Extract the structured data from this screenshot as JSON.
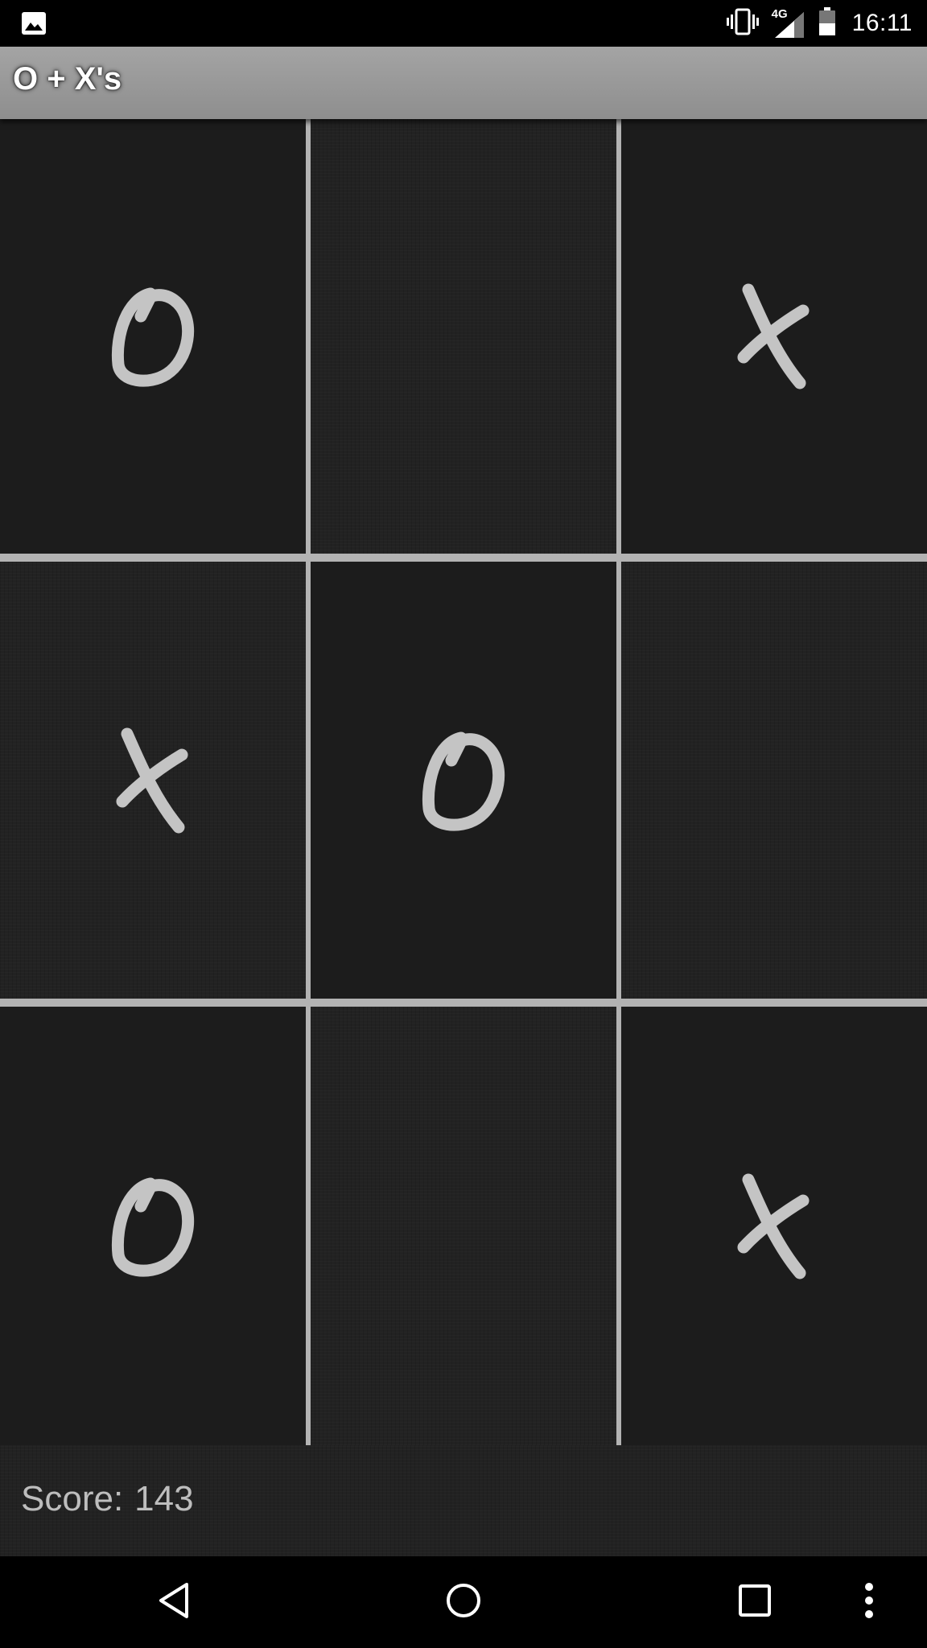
{
  "status_bar": {
    "time": "16:11",
    "network": "4G",
    "icons": [
      "image-notification-icon",
      "vibrate-icon",
      "signal-4g-icon",
      "battery-icon"
    ]
  },
  "app_bar": {
    "title": "O + X's"
  },
  "board": {
    "cells": [
      "O",
      "",
      "X",
      "X",
      "O",
      "",
      "O",
      "",
      "X"
    ],
    "line_color": "#b3b3b3",
    "mark_color": "#c4c4c4"
  },
  "score": {
    "label": "Score:",
    "value": "143"
  },
  "nav_bar": {
    "buttons": [
      "back-icon",
      "home-icon",
      "recents-icon",
      "overflow-menu-icon"
    ]
  }
}
